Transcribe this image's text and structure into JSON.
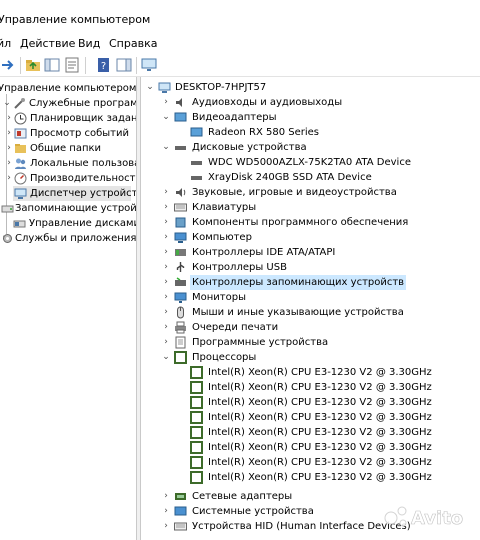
{
  "window": {
    "title": "Управление компьютером"
  },
  "menu": [
    "йл",
    "Действие",
    "Вид",
    "Справка"
  ],
  "left_tree": [
    "Управление компьютером (л",
    "Служебные программы",
    "Планировщик заданий",
    "Просмотр событий",
    "Общие папки",
    "Локальные пользовате",
    "Производительность",
    "Диспетчер устройств",
    "Запоминающие устройст",
    "Управление дисками",
    "Службы и приложения"
  ],
  "right_tree": {
    "root": "DESKTOP-7HPJT57",
    "items": [
      "Аудиовходы и аудиовыходы",
      "Видеоадаптеры",
      "Radeon RX 580 Series",
      "Дисковые устройства",
      "WDC WD5000AZLX-75K2TA0 ATA Device",
      "XrayDisk 240GB SSD ATA Device",
      "Звуковые, игровые и видеоустройства",
      "Клавиатуры",
      "Компоненты программного обеспечения",
      "Компьютер",
      "Контроллеры IDE ATA/ATAPI",
      "Контроллеры USB",
      "Контроллеры запоминающих устройств",
      "Мониторы",
      "Мыши и иные указывающие устройства",
      "Очереди печати",
      "Программные устройства",
      "Процессоры",
      "Intel(R) Xeon(R) CPU E3-1230 V2 @ 3.30GHz",
      "Intel(R) Xeon(R) CPU E3-1230 V2 @ 3.30GHz",
      "Intel(R) Xeon(R) CPU E3-1230 V2 @ 3.30GHz",
      "Intel(R) Xeon(R) CPU E3-1230 V2 @ 3.30GHz",
      "Intel(R) Xeon(R) CPU E3-1230 V2 @ 3.30GHz",
      "Intel(R) Xeon(R) CPU E3-1230 V2 @ 3.30GHz",
      "Intel(R) Xeon(R) CPU E3-1230 V2 @ 3.30GHz",
      "Intel(R) Xeon(R) CPU E3-1230 V2 @ 3.30GHz",
      "Сетевые адаптеры",
      "Системные устройства",
      "Устройства HID (Human Interface Devices)"
    ]
  },
  "watermark": {
    "text": "Avito"
  },
  "colors": {
    "selected_bg": "#e5e5e5",
    "highlight_bg": "#cce8ff",
    "folder": "#e8c15a",
    "chip": "#3d6b2a"
  }
}
